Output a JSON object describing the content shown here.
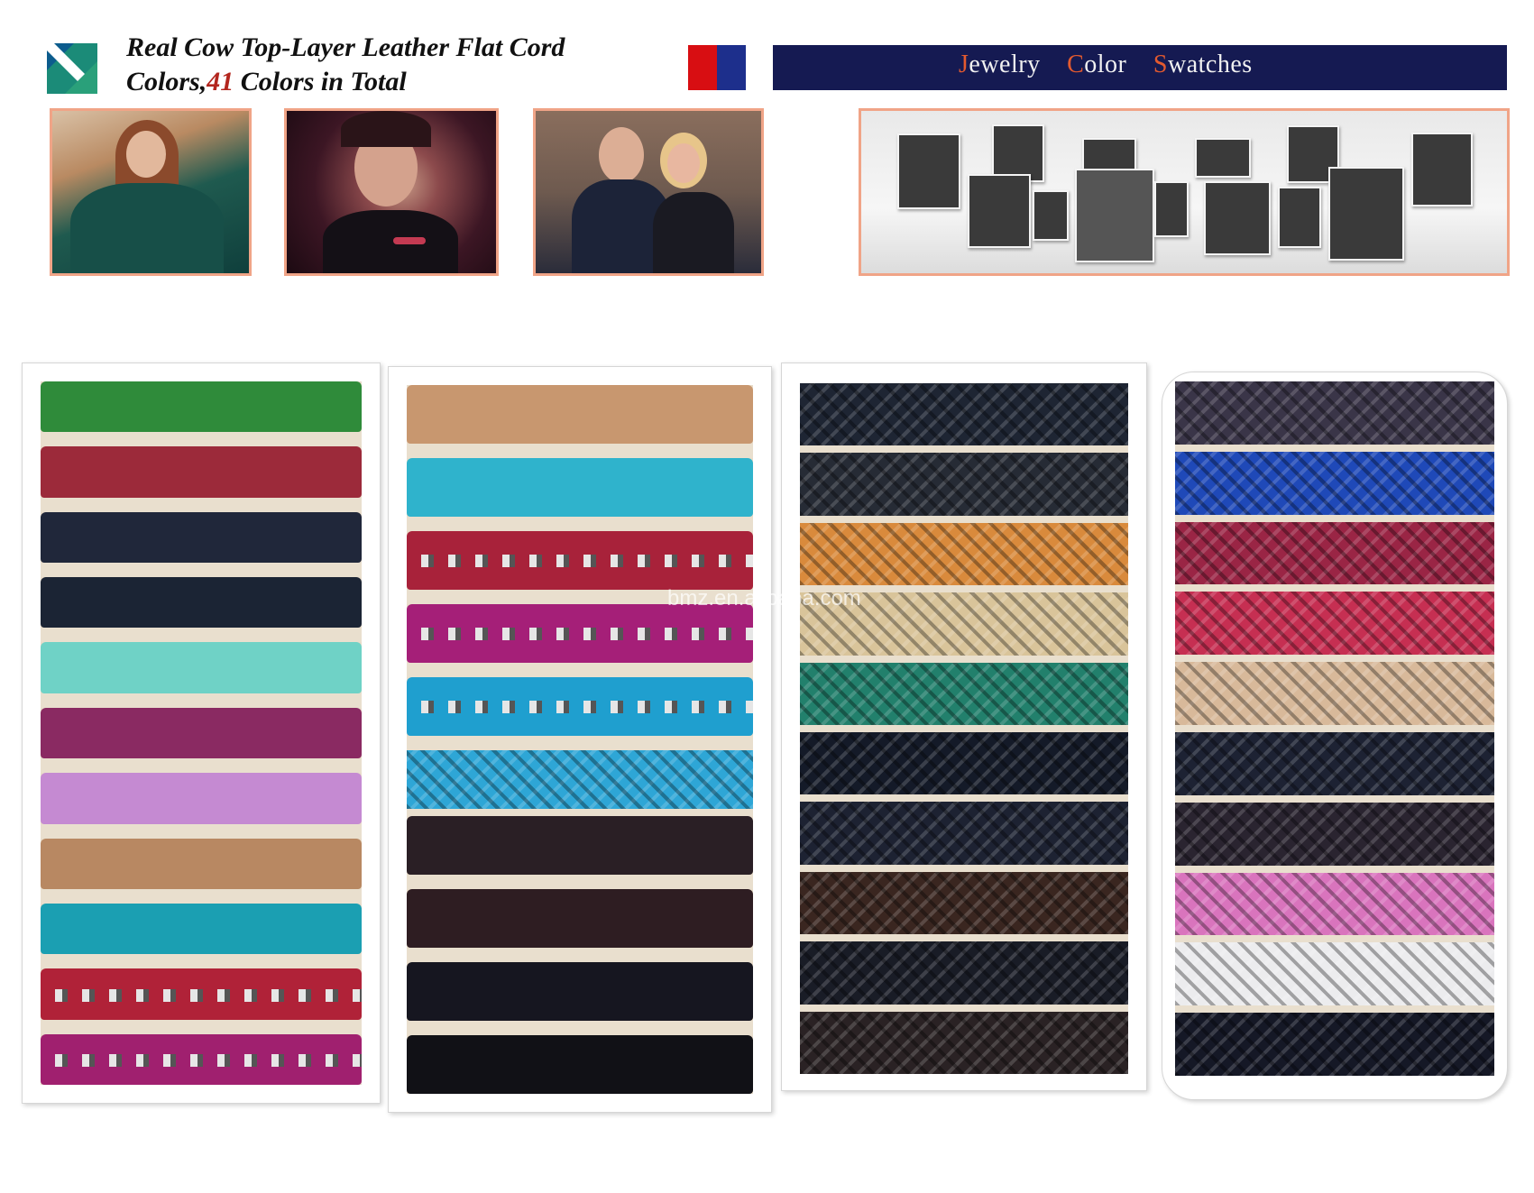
{
  "header": {
    "title_line1": "Real Cow Top-Layer Leather Flat Cord",
    "title_line2_prefix": "Colors,",
    "title_line2_number": "41",
    "title_line2_suffix": " Colors in Total",
    "logo_icon": "diagonal-teal-logo"
  },
  "banner": {
    "w1_cap": "J",
    "w1_rest": "ewelry",
    "w2_cap": "C",
    "w2_rest": "olor",
    "w3_cap": "S",
    "w3_rest": "watches",
    "flag_colors": [
      "#d80e12",
      "#1d2f8c",
      "#ffffff"
    ],
    "background": "#151a52",
    "accent": "#e35a2f"
  },
  "photos": [
    {
      "name": "model-green-outfit"
    },
    {
      "name": "model-bracelet"
    },
    {
      "name": "couple"
    },
    {
      "name": "gallery-portraits"
    }
  ],
  "watermark": "bmz.en.alibaba.com",
  "panels": [
    {
      "name": "flat-cords-panel-1",
      "strips": [
        {
          "color": "#2f8b3a",
          "style": "flat"
        },
        {
          "color": "#9c2a3a",
          "style": "flat"
        },
        {
          "color": "#20273a",
          "style": "flat"
        },
        {
          "color": "#1b2434",
          "style": "flat"
        },
        {
          "color": "#6fd2c6",
          "style": "flat"
        },
        {
          "color": "#8a2a62",
          "style": "flat"
        },
        {
          "color": "#c58ad2",
          "style": "flat"
        },
        {
          "color": "#b88862",
          "style": "flat"
        },
        {
          "color": "#1b9fb2",
          "style": "flat"
        },
        {
          "color": "#b02238",
          "style": "rhinestone"
        },
        {
          "color": "#a0206f",
          "style": "rhinestone"
        }
      ]
    },
    {
      "name": "flat-cords-panel-2",
      "strips": [
        {
          "color": "#c8976f",
          "style": "flat"
        },
        {
          "color": "#2fb3cc",
          "style": "flat"
        },
        {
          "color": "#a8223a",
          "style": "rhinestone"
        },
        {
          "color": "#a51f78",
          "style": "rhinestone"
        },
        {
          "color": "#1f9fcf",
          "style": "rhinestone"
        },
        {
          "color": "#2ea6d6",
          "style": "braid"
        },
        {
          "color": "#2a1f25",
          "style": "flat"
        },
        {
          "color": "#2e1d22",
          "style": "flat"
        },
        {
          "color": "#161620",
          "style": "flat"
        },
        {
          "color": "#111116",
          "style": "flat"
        }
      ]
    },
    {
      "name": "braided-cords-panel-3",
      "strips": [
        {
          "color": "#1e2533",
          "style": "braid"
        },
        {
          "color": "#262b35",
          "style": "braid"
        },
        {
          "color": "#d98a3c",
          "style": "braid"
        },
        {
          "color": "#d9c49a",
          "style": "braid"
        },
        {
          "color": "#22806c",
          "style": "braid"
        },
        {
          "color": "#141a28",
          "style": "braid"
        },
        {
          "color": "#1d2232",
          "style": "braid"
        },
        {
          "color": "#3a2620",
          "style": "braid"
        },
        {
          "color": "#191c26",
          "style": "braid"
        },
        {
          "color": "#2a2224",
          "style": "braid"
        }
      ]
    },
    {
      "name": "braided-cords-panel-4",
      "strips": [
        {
          "color": "#3a3548",
          "style": "braid"
        },
        {
          "color": "#1f49b8",
          "style": "braid"
        },
        {
          "color": "#9a2545",
          "style": "braid"
        },
        {
          "color": "#c62f52",
          "style": "braid"
        },
        {
          "color": "#d8b99a",
          "style": "braid"
        },
        {
          "color": "#1d2233",
          "style": "braid"
        },
        {
          "color": "#2a2430",
          "style": "braid"
        },
        {
          "color": "#d974bd",
          "style": "braid"
        },
        {
          "color": "#ececee",
          "style": "braid"
        },
        {
          "color": "#151826",
          "style": "braid"
        }
      ]
    }
  ]
}
